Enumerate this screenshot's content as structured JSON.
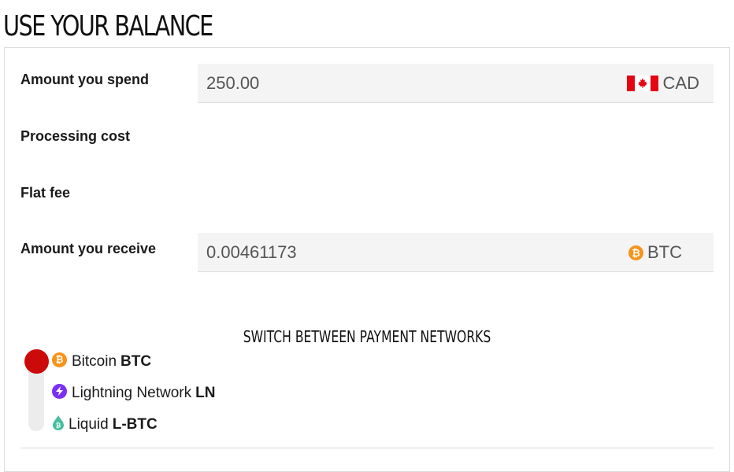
{
  "page": {
    "title": "USE YOUR BALANCE"
  },
  "form": {
    "spend_label": "Amount you spend",
    "spend_value": "250.00",
    "spend_currency": "CAD",
    "processing_label": "Processing cost",
    "flat_fee_label": "Flat fee",
    "receive_label": "Amount you receive",
    "receive_value": "0.00461173",
    "receive_currency": "BTC",
    "currency_icons": {
      "spend": "canada-flag-icon",
      "receive": "bitcoin-icon"
    }
  },
  "networks": {
    "title": "SWITCH BETWEEN PAYMENT NETWORKS",
    "selected_index": 0,
    "items": [
      {
        "name": "Bitcoin",
        "code": "BTC",
        "icon": "bitcoin-icon",
        "color": "#f7931a"
      },
      {
        "name": "Lightning Network",
        "code": "LN",
        "icon": "lightning-icon",
        "color": "#7b2ff2"
      },
      {
        "name": "Liquid",
        "code": "L-BTC",
        "icon": "liquid-drop-icon",
        "color": "#46bea0"
      }
    ]
  },
  "colors": {
    "selector_knob": "#cc0a0a",
    "field_bg": "#f4f4f4",
    "canada_red": "#e30613"
  }
}
